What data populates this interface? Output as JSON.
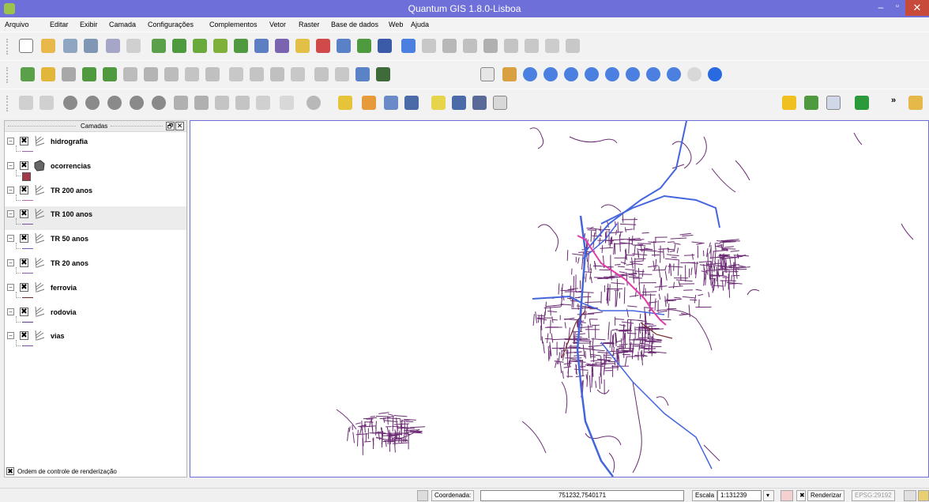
{
  "window": {
    "title": "Quantum GIS 1.8.0-Lisboa",
    "minimize": "–",
    "maximize": "▫",
    "close": "✕"
  },
  "menu": {
    "items": [
      "Arquivo",
      "Editar",
      "Exibir",
      "Camada",
      "Configurações",
      "Complementos",
      "Vetor",
      "Raster",
      "Base de dados",
      "Web",
      "Ajuda"
    ]
  },
  "toolbars": {
    "file": [
      "new-project-icon",
      "open-project-icon",
      "save-project-icon",
      "save-as-icon",
      "print-composer-icon",
      "composer-manager-icon"
    ],
    "layers": [
      "add-vector-icon",
      "add-raster-icon",
      "add-postgis-icon",
      "add-spatialite-icon",
      "add-mssql-icon",
      "add-wms-icon",
      "add-wfs-icon",
      "new-shapefile-icon",
      "remove-layer-icon",
      "new-spatialite-icon",
      "add-delimited-icon",
      "gps-icon"
    ],
    "edit": [
      "current-edits-icon",
      "toggle-editing-icon",
      "capture-line-icon",
      "move-feature-icon",
      "node-tool-icon",
      "delete-selected-icon",
      "cut-icon",
      "copy-icon",
      "paste-icon"
    ],
    "nav": [
      "pan-icon",
      "pan-to-selected-icon",
      "zoom-in-icon",
      "zoom-out-icon",
      "zoom-full-icon",
      "zoom-selection-icon",
      "zoom-layer-icon",
      "zoom-actual-icon",
      "zoom-last-icon",
      "zoom-next-icon",
      "refresh-icon"
    ],
    "labels": [
      "label-icon",
      "pin-label-icon",
      "show-hide-labels-icon",
      "move-label-icon",
      "rotate-label-icon",
      "change-label-icon"
    ],
    "attributes": [
      "identify-icon",
      "action-icon",
      "select-icon",
      "deselect-icon",
      "open-table-icon",
      "measure-icon",
      "map-tips-icon",
      "new-bookmark-icon",
      "show-bookmarks-icon",
      "text-annotation-icon"
    ],
    "right": [
      "d2s-icon",
      "add-layer-plugin-icon",
      "wfs-plugin-icon",
      "georef-icon",
      "more-icon"
    ]
  },
  "layers_panel": {
    "title": "Camadas",
    "float_button": "🗗",
    "close_button": "✕",
    "layers": [
      {
        "name": "hidrografia",
        "type": "line",
        "color": "#9966aa",
        "checked": "✖"
      },
      {
        "name": "ocorrencias",
        "type": "polygon",
        "color": "#a23a4a",
        "checked": "✖"
      },
      {
        "name": "TR 200 anos",
        "type": "line",
        "color": "#b86cb8",
        "checked": "✖"
      },
      {
        "name": "TR 100 anos",
        "type": "line",
        "color": "#7a4fa0",
        "checked": "✖"
      },
      {
        "name": "TR 50 anos",
        "type": "line",
        "color": "#6f5fb0",
        "checked": "✖"
      },
      {
        "name": "TR 20 anos",
        "type": "line",
        "color": "#8d5ca8",
        "checked": "✖"
      },
      {
        "name": "ferrovia",
        "type": "line",
        "color": "#6b2a2a",
        "checked": "✖"
      },
      {
        "name": "rodovia",
        "type": "line",
        "color": "#5c3a8c",
        "checked": "✖"
      },
      {
        "name": "vias",
        "type": "line",
        "color": "#7a4fa0",
        "checked": "✖"
      }
    ],
    "selected_index": 3,
    "render_order_label": "Ordem de controle de renderização",
    "render_order_checked": "✖"
  },
  "map": {
    "colors": {
      "streets": "#6b2b73",
      "roads": "#4466dd",
      "river": "#e23aa8",
      "rail": "#7a2a2a"
    }
  },
  "status": {
    "coordinate_label": "Coordenada:",
    "coordinate_value": "751232,7540171",
    "scale_label": "Escala",
    "scale_value": "1:131239",
    "render_label": "Renderizar",
    "render_checked": "✖",
    "crs": "EPSG:29192"
  }
}
